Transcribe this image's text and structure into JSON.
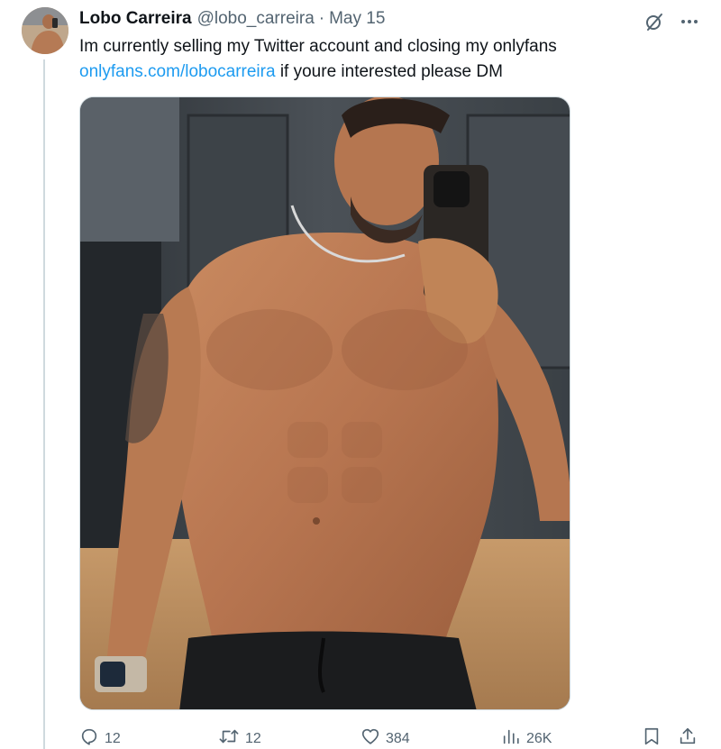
{
  "author": {
    "display_name": "Lobo Carreira",
    "handle": "@lobo_carreira",
    "separator": "·",
    "date": "May 15"
  },
  "tweet": {
    "text_line1": "Im currently selling my Twitter account and closing my onlyfans",
    "link_text": "onlyfans.com/lobocarreira",
    "text_line2_rest": " if youre interested please DM"
  },
  "media": {
    "description": "photo"
  },
  "actions": {
    "replies": "12",
    "retweets": "12",
    "likes": "384",
    "views": "26K"
  },
  "colors": {
    "link": "#1d9bf0",
    "muted": "#536471",
    "text": "#0f1419",
    "thread_line": "#cfd9de"
  },
  "icons": {
    "top": [
      "grok-icon",
      "more-icon"
    ],
    "actions": [
      "reply-icon",
      "retweet-icon",
      "like-icon",
      "views-icon",
      "bookmark-icon",
      "share-icon"
    ]
  }
}
